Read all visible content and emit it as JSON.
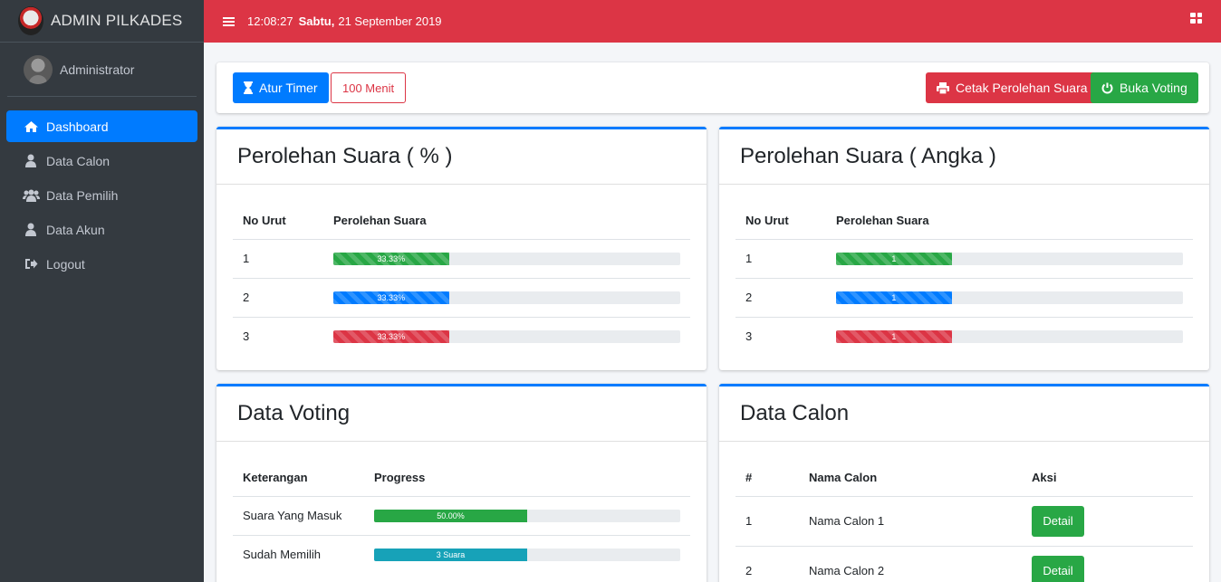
{
  "brand": {
    "title": "ADMIN PILKADES"
  },
  "user": {
    "name": "Administrator"
  },
  "sidebar": {
    "items": [
      {
        "label": "Dashboard",
        "icon": "home-icon",
        "active": true
      },
      {
        "label": "Data Calon",
        "icon": "user-icon"
      },
      {
        "label": "Data Pemilih",
        "icon": "users-icon"
      },
      {
        "label": "Data Akun",
        "icon": "user-icon"
      },
      {
        "label": "Logout",
        "icon": "sign-out-icon"
      }
    ]
  },
  "topbar": {
    "time": "12:08:27",
    "day": "Sabtu,",
    "date": "21 September 2019"
  },
  "toolbar": {
    "timer_label": "Atur Timer",
    "minutes_label": "100 Menit",
    "print_label": "Cetak Perolehan Suara",
    "open_voting_label": "Buka Voting"
  },
  "percent_card": {
    "title": "Perolehan Suara ( % )",
    "col_no": "No Urut",
    "col_votes": "Perolehan Suara",
    "rows": [
      {
        "no": "1",
        "label": "33.33%",
        "fraction": 0.3333,
        "color": "#28a745"
      },
      {
        "no": "2",
        "label": "33.33%",
        "fraction": 0.3333,
        "color": "#007bff"
      },
      {
        "no": "3",
        "label": "33.33%",
        "fraction": 0.3333,
        "color": "#dc3545"
      }
    ]
  },
  "count_card": {
    "title": "Perolehan Suara ( Angka )",
    "col_no": "No Urut",
    "col_votes": "Perolehan Suara",
    "rows": [
      {
        "no": "1",
        "label": "1",
        "fraction": 0.3333,
        "color": "#28a745"
      },
      {
        "no": "2",
        "label": "1",
        "fraction": 0.3333,
        "color": "#007bff"
      },
      {
        "no": "3",
        "label": "1",
        "fraction": 0.3333,
        "color": "#dc3545"
      }
    ]
  },
  "voting_card": {
    "title": "Data Voting",
    "col_desc": "Keterangan",
    "col_progress": "Progress",
    "rows": [
      {
        "label": "Suara Yang Masuk",
        "bar_label": "50.00%",
        "fraction": 0.5,
        "color": "#28a745"
      },
      {
        "label": "Sudah Memilih",
        "bar_label": "3 Suara",
        "fraction": 0.5,
        "color": "#17a2b8"
      }
    ]
  },
  "calon_card": {
    "title": "Data Calon",
    "col_no": "#",
    "col_name": "Nama Calon",
    "col_action": "Aksi",
    "rows": [
      {
        "no": "1",
        "name": "Nama Calon 1",
        "action": "Detail"
      },
      {
        "no": "2",
        "name": "Nama Calon 2",
        "action": "Detail"
      }
    ]
  }
}
